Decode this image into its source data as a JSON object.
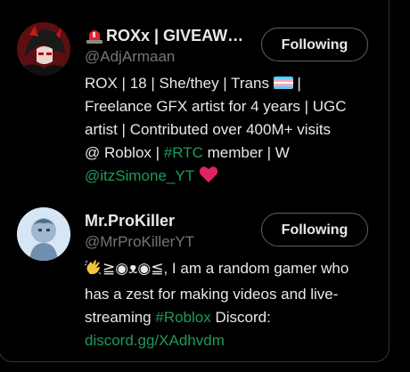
{
  "users": [
    {
      "name": "ROXx | GIVEAW…",
      "handle": "@AdjArmaan",
      "follow_label": "Following",
      "bio": {
        "line1_a": "ROX | 18 | She/they | Trans",
        "line1_b": " |",
        "line2": "Freelance GFX artist for 4 years | UGC",
        "line3": "artist | Contributed over 400M+ visits",
        "line4_a": "@ Roblox | ",
        "line4_link": "#RTC",
        "line4_b": " member | W",
        "line5_link": "@itzSimone_YT"
      },
      "emoji_icons": [
        "siren-icon",
        "transgender-flag-icon",
        "red-heart-icon"
      ]
    },
    {
      "name": "Mr.ProKiller",
      "handle": "@MrProKillerYT",
      "follow_label": "Following",
      "bio": {
        "line1": "≧◉ᴥ◉≦, I am a random gamer who",
        "line2": "has a zest for making videos and live-",
        "line3_a": "streaming ",
        "line3_link": "#Roblox",
        "line3_b": " Discord:",
        "line4_link": "discord.gg/XAdhvdm"
      },
      "emoji_icons": [
        "waving-hand-icon"
      ]
    }
  ],
  "colors": {
    "background": "#000000",
    "text": "#e7e9ea",
    "secondary": "#71767b",
    "link": "#1d9a5b",
    "border": "#2f3336",
    "heart": "#e0245e"
  }
}
